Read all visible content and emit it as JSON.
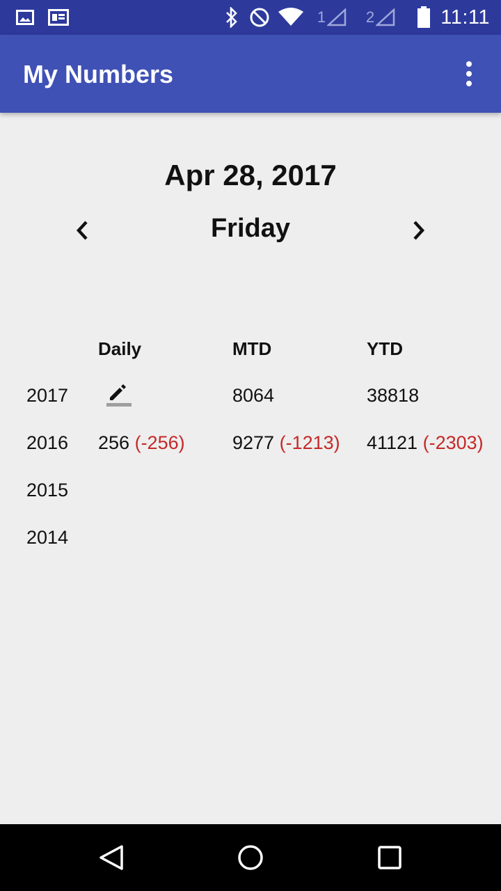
{
  "status_bar": {
    "time": "11:11",
    "sim1_label": "1",
    "sim2_label": "2",
    "icons": [
      "image-icon",
      "news-icon",
      "bluetooth-icon",
      "do-not-disturb-icon",
      "wifi-icon",
      "signal-icon",
      "battery-icon"
    ]
  },
  "app_bar": {
    "title": "My Numbers",
    "overflow_icon": "more-vert-icon"
  },
  "date": {
    "full": "Apr 28, 2017",
    "weekday": "Friday",
    "prev_icon": "chevron-left-icon",
    "next_icon": "chevron-right-icon"
  },
  "table": {
    "columns": [
      "Daily",
      "MTD",
      "YTD"
    ],
    "rows": [
      {
        "year": "2017",
        "daily": null,
        "daily_icon": "edit-icon",
        "mtd": "8064",
        "mtd_diff": "",
        "ytd": "38818",
        "ytd_diff": ""
      },
      {
        "year": "2016",
        "daily": "256",
        "daily_diff": "(-256)",
        "mtd": "9277",
        "mtd_diff": "(-1213)",
        "ytd": "41121",
        "ytd_diff": "(-2303)"
      },
      {
        "year": "2015"
      },
      {
        "year": "2014"
      }
    ],
    "negative_color": "#c62828"
  },
  "colors": {
    "status_bar": "#2d3a9c",
    "app_bar": "#3f51b5",
    "background": "#eeeeee"
  },
  "nav_bar": {
    "icons": [
      "back-icon",
      "home-icon",
      "recents-icon"
    ]
  }
}
